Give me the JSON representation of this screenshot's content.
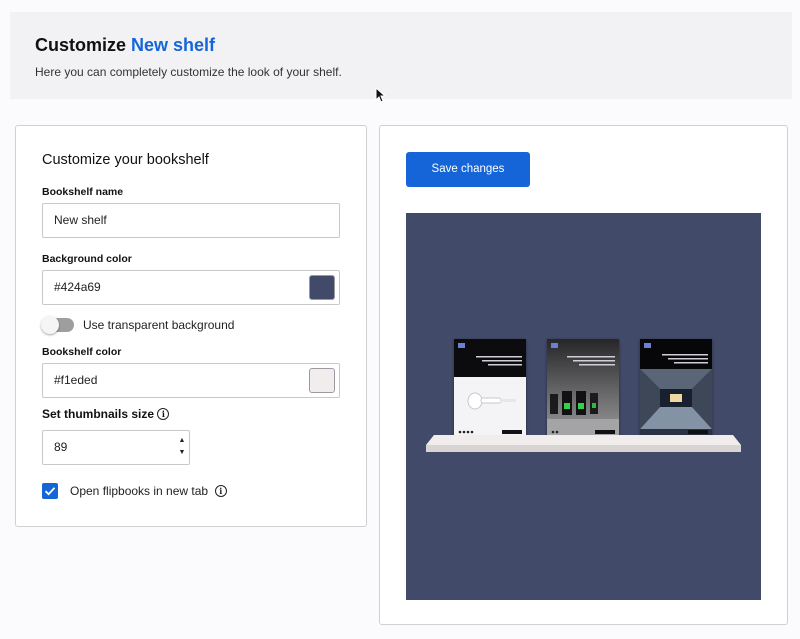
{
  "header": {
    "title_prefix": "Customize",
    "title_accent": "New shelf",
    "subtitle": "Here you can completely customize the look of your shelf."
  },
  "form": {
    "heading": "Customize your bookshelf",
    "name_label": "Bookshelf name",
    "name_value": "New shelf",
    "bg_label": "Background color",
    "bg_value": "#424a69",
    "transparent_label": "Use transparent background",
    "transparent_on": false,
    "shelf_label": "Bookshelf color",
    "shelf_value": "#f1eded",
    "thumb_label": "Set thumbnails size",
    "thumb_value": "89",
    "newtab_label": "Open flipbooks in new tab",
    "newtab_checked": true
  },
  "preview": {
    "save_label": "Save changes"
  },
  "colors": {
    "accent": "#1565d8",
    "background": "#424a69",
    "shelf": "#f1eded"
  }
}
